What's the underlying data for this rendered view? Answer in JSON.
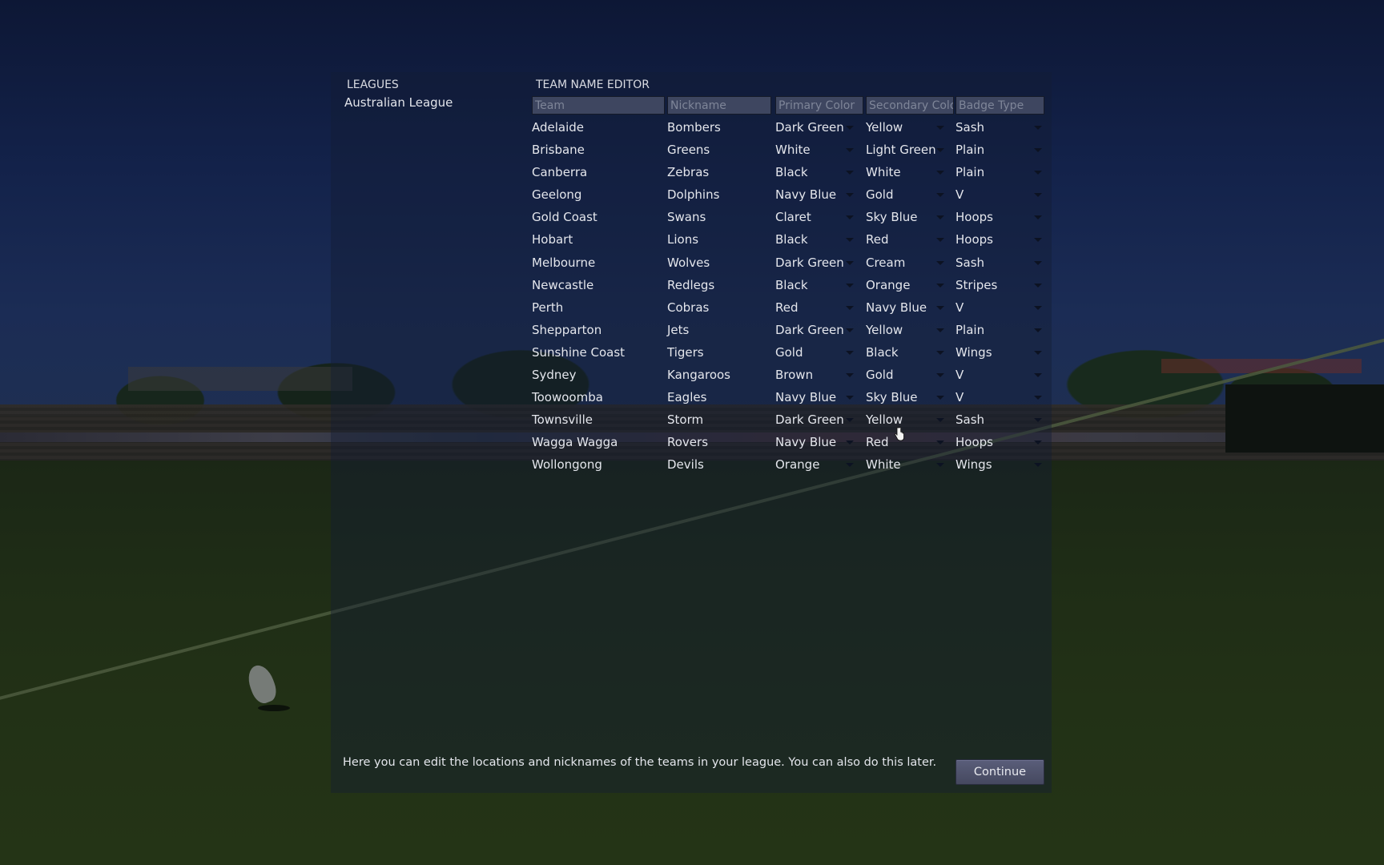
{
  "leagues": {
    "title": "LEAGUES",
    "items": [
      "Australian League"
    ]
  },
  "editor": {
    "title": "TEAM NAME EDITOR",
    "columns": [
      "Team",
      "Nickname",
      "Primary Color",
      "Secondary Colo",
      "Badge Type"
    ],
    "rows": [
      {
        "team": "Adelaide",
        "nickname": "Bombers",
        "primary": "Dark Green",
        "secondary": "Yellow",
        "badge": "Sash"
      },
      {
        "team": "Brisbane",
        "nickname": "Greens",
        "primary": "White",
        "secondary": "Light Green",
        "badge": "Plain"
      },
      {
        "team": "Canberra",
        "nickname": "Zebras",
        "primary": "Black",
        "secondary": "White",
        "badge": "Plain"
      },
      {
        "team": "Geelong",
        "nickname": "Dolphins",
        "primary": "Navy Blue",
        "secondary": "Gold",
        "badge": "V"
      },
      {
        "team": "Gold Coast",
        "nickname": "Swans",
        "primary": "Claret",
        "secondary": "Sky Blue",
        "badge": "Hoops"
      },
      {
        "team": "Hobart",
        "nickname": "Lions",
        "primary": "Black",
        "secondary": "Red",
        "badge": "Hoops"
      },
      {
        "team": "Melbourne",
        "nickname": "Wolves",
        "primary": "Dark Green",
        "secondary": "Cream",
        "badge": "Sash"
      },
      {
        "team": "Newcastle",
        "nickname": "Redlegs",
        "primary": "Black",
        "secondary": "Orange",
        "badge": "Stripes"
      },
      {
        "team": "Perth",
        "nickname": "Cobras",
        "primary": "Red",
        "secondary": "Navy Blue",
        "badge": "V"
      },
      {
        "team": "Shepparton",
        "nickname": "Jets",
        "primary": "Dark Green",
        "secondary": "Yellow",
        "badge": "Plain"
      },
      {
        "team": "Sunshine Coast",
        "nickname": "Tigers",
        "primary": "Gold",
        "secondary": "Black",
        "badge": "Wings"
      },
      {
        "team": "Sydney",
        "nickname": "Kangaroos",
        "primary": "Brown",
        "secondary": "Gold",
        "badge": "V"
      },
      {
        "team": "Toowoomba",
        "nickname": "Eagles",
        "primary": "Navy Blue",
        "secondary": "Sky Blue",
        "badge": "V"
      },
      {
        "team": "Townsville",
        "nickname": "Storm",
        "primary": "Dark Green",
        "secondary": "Yellow",
        "badge": "Sash"
      },
      {
        "team": "Wagga Wagga",
        "nickname": "Rovers",
        "primary": "Navy Blue",
        "secondary": "Red",
        "badge": "Hoops"
      },
      {
        "team": "Wollongong",
        "nickname": "Devils",
        "primary": "Orange",
        "secondary": "White",
        "badge": "Wings"
      }
    ]
  },
  "footer": {
    "message": "Here you can edit the locations and nicknames of the teams in your league. You can also do this later.",
    "continue_label": "Continue"
  },
  "icons": {
    "dropdown": "dropdown-arrow-icon",
    "cursor": "hand-pointer-cursor-icon"
  }
}
